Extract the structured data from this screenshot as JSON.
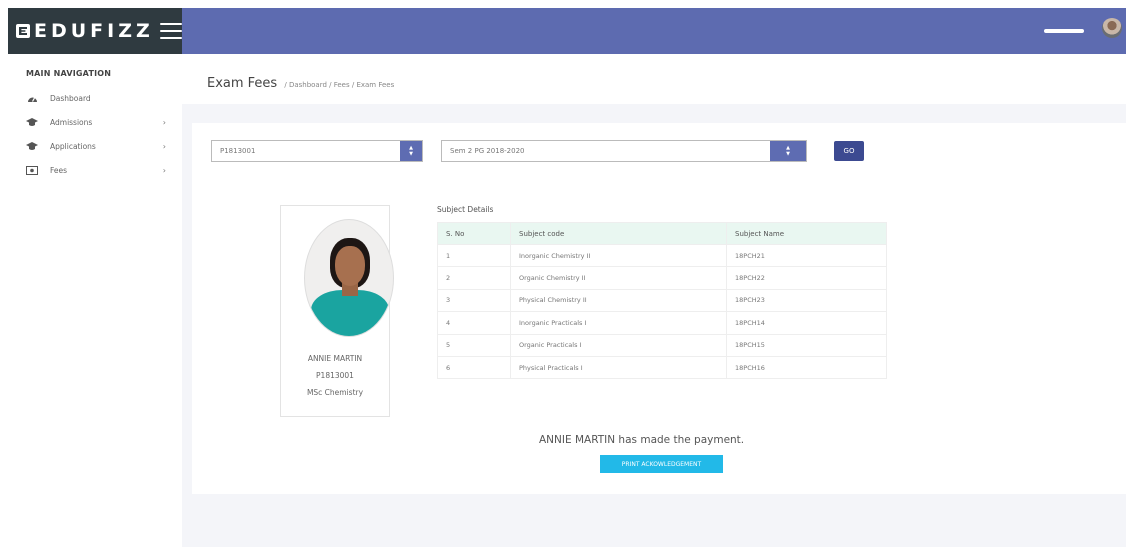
{
  "header": {
    "logo_text": "EDUFIZZ"
  },
  "sidebar": {
    "section_title": "MAIN NAVIGATION",
    "items": [
      {
        "label": "Dashboard",
        "icon": "dashboard-icon"
      },
      {
        "label": "Admissions",
        "icon": "graduation-cap-icon"
      },
      {
        "label": "Applications",
        "icon": "graduation-cap-icon"
      },
      {
        "label": "Fees",
        "icon": "money-bill-icon"
      }
    ]
  },
  "page": {
    "title": "Exam Fees",
    "breadcrumb": "/ Dashboard / Fees / Exam Fees"
  },
  "filters": {
    "student_id_value": "P1813001",
    "semester_value": "Sem 2 PG 2018-2020",
    "go_label": "GO"
  },
  "student": {
    "name": "ANNIE MARTIN",
    "id": "P1813001",
    "course": "MSc Chemistry"
  },
  "subjects": {
    "title": "Subject Details",
    "columns": [
      "S. No",
      "Subject code",
      "Subject Name"
    ],
    "rows": [
      [
        "1",
        "Inorganic Chemistry II",
        "18PCH21"
      ],
      [
        "2",
        "Organic Chemistry II",
        "18PCH22"
      ],
      [
        "3",
        "Physical Chemistry II",
        "18PCH23"
      ],
      [
        "4",
        "Inorganic Practicals I",
        "18PCH14"
      ],
      [
        "5",
        "Organic Practicals I",
        "18PCH15"
      ],
      [
        "6",
        "Physical Practicals I",
        "18PCH16"
      ]
    ]
  },
  "payment": {
    "message": "ANNIE MARTIN has made the payment.",
    "print_label": "PRINT ACKOWLEDGEMENT"
  },
  "colors": {
    "topbar": "#5d6bb0",
    "logo_bg": "#2f3a40",
    "go_button": "#3c4a91",
    "print_button": "#22b9e8",
    "table_header": "#e9f7f1"
  }
}
